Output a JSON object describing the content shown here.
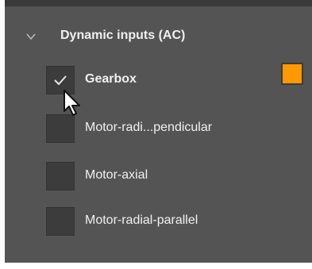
{
  "section": {
    "title": "Dynamic inputs (AC)",
    "expanded": true,
    "chevron_icon": "chevron-down-icon"
  },
  "items": [
    {
      "label": "Gearbox",
      "checked": true,
      "bold": true,
      "color": "#ff9900"
    },
    {
      "label": "Motor-radi...pendicular",
      "checked": false,
      "bold": false
    },
    {
      "label": "Motor-axial",
      "checked": false,
      "bold": false
    },
    {
      "label": "Motor-radial-parallel",
      "checked": false,
      "bold": false
    }
  ],
  "colors": {
    "panel_background": "#545454",
    "text": "#f0f0f0",
    "checkbox_background": "#3c3c3c",
    "gearbox_swatch": "#ff9900"
  },
  "cursor_icon": "mouse-pointer-icon"
}
